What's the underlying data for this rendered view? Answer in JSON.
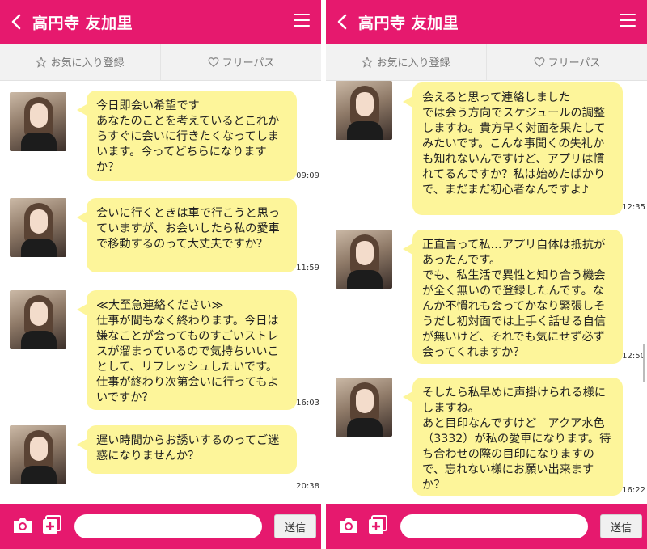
{
  "screens": [
    {
      "header": {
        "title": "高円寺 友加里"
      },
      "actions": {
        "favorite": "お気に入り登録",
        "free_pass": "フリーパス"
      },
      "messages": [
        {
          "text": "今日即会い希望です\nあなたのことを考えているとこれからすぐに会いに行きたくなってしまいます。今ってどちらになりますか？",
          "time": "09:09"
        },
        {
          "text": "会いに行くときは車で行こうと思っていますが、お会いしたら私の愛車で移動するのって大丈夫ですか？",
          "time": "11:59"
        },
        {
          "text": "≪大至急連絡ください≫\n仕事が間もなく終わります。今日は嫌なことが会ってものすごいストレスが溜まっているので気持ちいいことして、リフレッシュしたいです。仕事が終わり次第会いに行ってもよいですか？",
          "time": "16:03"
        },
        {
          "text": "遅い時間からお誘いするのってご迷惑になりませんか？",
          "time": "20:38"
        }
      ],
      "footer": {
        "send_label": "送信",
        "input_value": ""
      }
    },
    {
      "header": {
        "title": "高円寺 友加里"
      },
      "actions": {
        "favorite": "お気に入り登録",
        "free_pass": "フリーパス"
      },
      "messages": [
        {
          "text": "会えると思って連絡しました\nでは会う方向でスケジュールの調整しますね。貴方早く対面を果たしてみたいです。こんな事聞くの失礼かも知れないんですけど、アプリは慣れてるんですか？私は始めたばかりで、まだまだ初心者なんですよ♪",
          "time": "12:35"
        },
        {
          "text": "正直言って私…アプリ自体は抵抗があったんです。\nでも、私生活で異性と知り合う機会が全く無いので登録したんです。なんか不慣れも会ってかなり緊張しそうだし初対面では上手く話せる自信が無いけど、それでも気にせず必ず会ってくれますか？",
          "time": "12:50"
        },
        {
          "text": "そしたら私早めに声掛けられる様にしますね。\nあと目印なんですけど　アクア水色（3332）が私の愛車になります。待ち合わせの際の目印になりますので、忘れない様にお願い出来ますか？",
          "time": "16:22"
        }
      ],
      "footer": {
        "send_label": "送信",
        "input_value": ""
      }
    }
  ],
  "colors": {
    "brand": "#e6196e",
    "bubble": "#fdf59a"
  },
  "icons": [
    "back-icon",
    "menu-icon",
    "star-icon",
    "heart-icon",
    "camera-icon",
    "add-image-icon"
  ]
}
